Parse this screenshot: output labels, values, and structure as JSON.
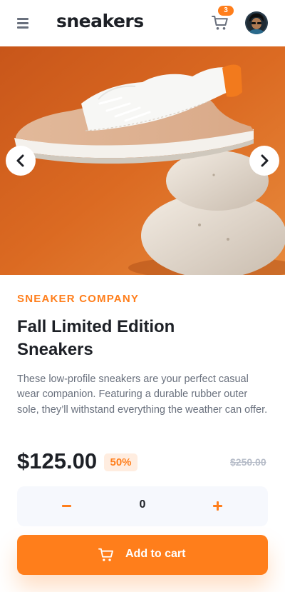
{
  "header": {
    "logo": "sneakers",
    "cart_count": "3",
    "menu_icon": "hamburger-menu-icon",
    "cart_icon": "shopping-cart-icon"
  },
  "gallery": {
    "prev_icon": "chevron-left-icon",
    "next_icon": "chevron-right-icon"
  },
  "product": {
    "company": "SNEAKER COMPANY",
    "title_line1": "Fall Limited Edition",
    "title_line2": "Sneakers",
    "description": "These low-profile sneakers are your perfect casual wear companion. Featuring a durable rubber outer sole, they’ll withstand everything the weather can offer.",
    "price": "$125.00",
    "discount": "50%",
    "original_price": "$250.00"
  },
  "quantity": {
    "value": "0"
  },
  "actions": {
    "add_to_cart": "Add to cart"
  },
  "colors": {
    "accent": "#ff7e1b",
    "accent_pale": "#ffede0",
    "dark": "#1d2026",
    "muted": "#69707d",
    "light_bg": "#f6f8fd"
  }
}
